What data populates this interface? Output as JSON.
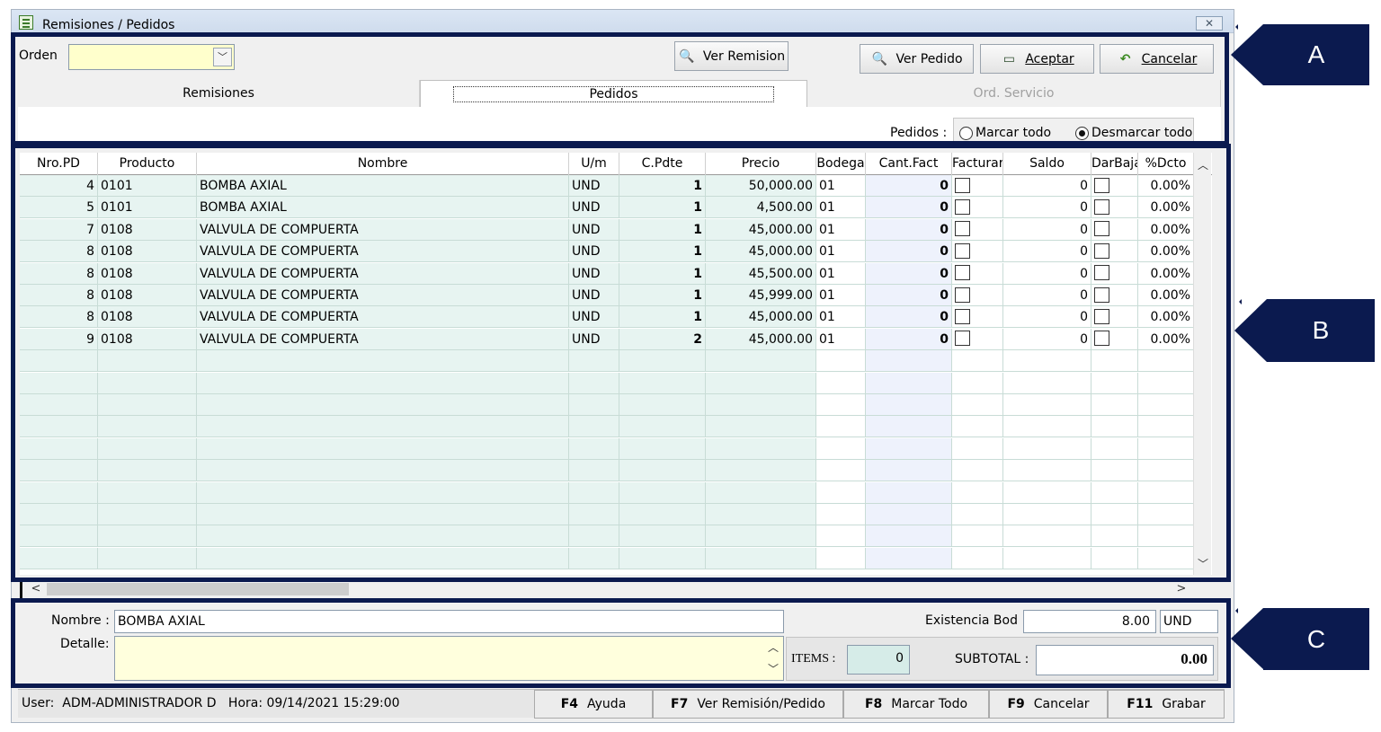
{
  "window": {
    "title": "Remisiones / Pedidos",
    "close_glyph": "✕"
  },
  "callouts": {
    "a": "A",
    "b": "B",
    "c": "C"
  },
  "toolbar": {
    "orden_label": "Orden",
    "orden_value": "",
    "ver_remision": "Ver Remision",
    "ver_pedido": "Ver Pedido",
    "aceptar": "Aceptar",
    "cancelar": "Cancelar"
  },
  "tabs": [
    {
      "label": "Remisiones",
      "state": "normal"
    },
    {
      "label": "Pedidos",
      "state": "active"
    },
    {
      "label": "Ord. Servicio",
      "state": "disabled"
    }
  ],
  "pedidos_filter": {
    "label": "Pedidos :",
    "option_marcar": "Marcar todo",
    "option_desmarcar": "Desmarcar todo",
    "selected": "Desmarcar todo"
  },
  "grid": {
    "columns": [
      "Nro.PD",
      "Producto",
      "Nombre",
      "U/m",
      "C.Pdte",
      "Precio",
      "Bodega",
      "Cant.Fact",
      "Facturar",
      "Saldo",
      "DarBaja",
      "%Dcto"
    ],
    "rows": [
      {
        "nro": "4",
        "producto": "0101",
        "nombre": "BOMBA AXIAL",
        "um": "UND",
        "cpdte": "1",
        "precio": "50,000.00",
        "bodega": "01",
        "cantfact": "0",
        "facturar": false,
        "saldo": "0",
        "darbaja": false,
        "dcto": "0.00%"
      },
      {
        "nro": "5",
        "producto": "0101",
        "nombre": "BOMBA AXIAL",
        "um": "UND",
        "cpdte": "1",
        "precio": "4,500.00",
        "bodega": "01",
        "cantfact": "0",
        "facturar": false,
        "saldo": "0",
        "darbaja": false,
        "dcto": "0.00%"
      },
      {
        "nro": "7",
        "producto": "0108",
        "nombre": "VALVULA DE COMPUERTA",
        "um": "UND",
        "cpdte": "1",
        "precio": "45,000.00",
        "bodega": "01",
        "cantfact": "0",
        "facturar": false,
        "saldo": "0",
        "darbaja": false,
        "dcto": "0.00%"
      },
      {
        "nro": "8",
        "producto": "0108",
        "nombre": "VALVULA DE COMPUERTA",
        "um": "UND",
        "cpdte": "1",
        "precio": "45,000.00",
        "bodega": "01",
        "cantfact": "0",
        "facturar": false,
        "saldo": "0",
        "darbaja": false,
        "dcto": "0.00%"
      },
      {
        "nro": "8",
        "producto": "0108",
        "nombre": "VALVULA DE COMPUERTA",
        "um": "UND",
        "cpdte": "1",
        "precio": "45,500.00",
        "bodega": "01",
        "cantfact": "0",
        "facturar": false,
        "saldo": "0",
        "darbaja": false,
        "dcto": "0.00%"
      },
      {
        "nro": "8",
        "producto": "0108",
        "nombre": "VALVULA DE COMPUERTA",
        "um": "UND",
        "cpdte": "1",
        "precio": "45,999.00",
        "bodega": "01",
        "cantfact": "0",
        "facturar": false,
        "saldo": "0",
        "darbaja": false,
        "dcto": "0.00%"
      },
      {
        "nro": "8",
        "producto": "0108",
        "nombre": "VALVULA DE COMPUERTA",
        "um": "UND",
        "cpdte": "1",
        "precio": "45,000.00",
        "bodega": "01",
        "cantfact": "0",
        "facturar": false,
        "saldo": "0",
        "darbaja": false,
        "dcto": "0.00%"
      },
      {
        "nro": "9",
        "producto": "0108",
        "nombre": "VALVULA DE COMPUERTA",
        "um": "UND",
        "cpdte": "2",
        "precio": "45,000.00",
        "bodega": "01",
        "cantfact": "0",
        "facturar": false,
        "saldo": "0",
        "darbaja": false,
        "dcto": "0.00%"
      }
    ]
  },
  "detail": {
    "nombre_label": "Nombre :",
    "nombre_value": "BOMBA AXIAL",
    "detalle_label": "Detalle:",
    "detalle_value": "",
    "existencia_label": "Existencia Bod :",
    "existencia_value": "8.00",
    "existencia_unit": "UND",
    "items_label": "ITEMS :",
    "items_value": "0",
    "subtotal_label": "SUBTOTAL :",
    "subtotal_value": "0.00"
  },
  "status": {
    "user": "User:  ADM-ADMINISTRADOR D   Hora: 09/14/2021 15:29:00",
    "keys": [
      {
        "key": "F4",
        "label": "Ayuda"
      },
      {
        "key": "F7",
        "label": "Ver Remisión/Pedido"
      },
      {
        "key": "F8",
        "label": "Marcar Todo"
      },
      {
        "key": "F9",
        "label": "Cancelar"
      },
      {
        "key": "F11",
        "label": "Grabar"
      }
    ]
  },
  "colors": {
    "annotation": "#0b1a4f",
    "combo_bg": "#ffffcc",
    "row_tint": "#e7f4f1"
  }
}
